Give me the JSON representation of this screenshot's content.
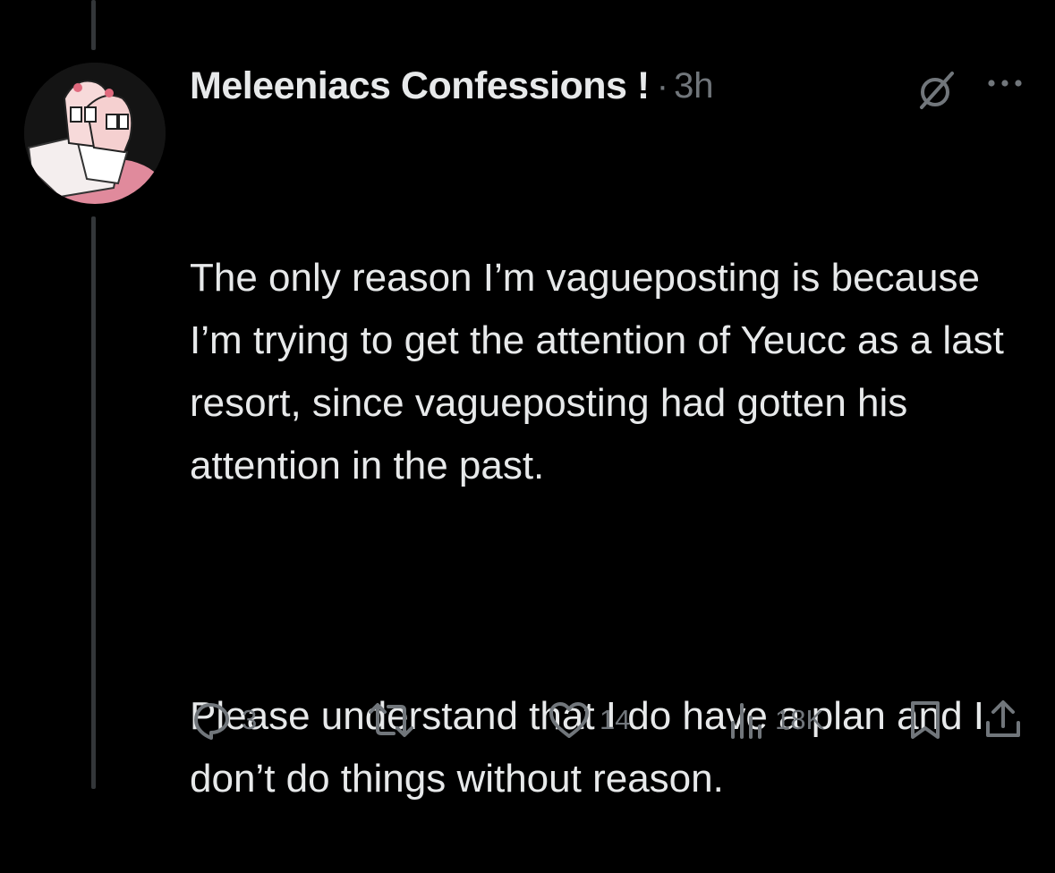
{
  "post": {
    "display_name": "Meleeniacs Confessions !",
    "separator": "·",
    "time": "3h",
    "paragraphs": [
      "The only reason I’m vagueposting is because I’m trying to get the attention of Yeucc as a last resort, since vagueposting had gotten his attention in the past.",
      "Please understand that I do have a plan and I don’t do things without reason."
    ]
  },
  "actions": {
    "replies": "3",
    "reposts": "",
    "likes": "14",
    "views": "18K"
  },
  "icons": {
    "grok": "grok-icon",
    "more": "more-icon",
    "reply": "reply-icon",
    "repost": "repost-icon",
    "like": "heart-icon",
    "views": "views-icon",
    "bookmark": "bookmark-icon",
    "share": "share-icon"
  },
  "colors": {
    "background": "#000000",
    "text_primary": "#e7e9ea",
    "text_secondary": "#71767b",
    "thread_line": "#333639"
  }
}
